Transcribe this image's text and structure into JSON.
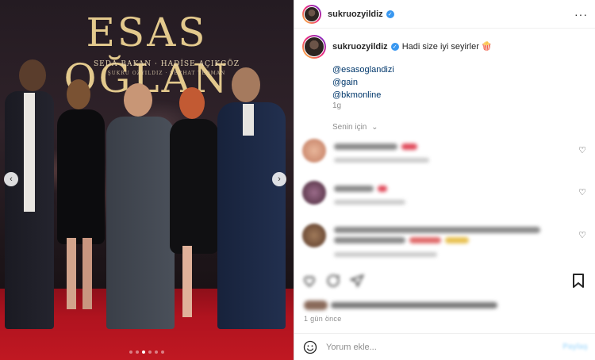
{
  "poster": {
    "title": "ESAS OĞLAN",
    "names_line1": "SEDA BAKAN · HADİSE AÇIKGÖZ",
    "names_line2": "ŞÜKRÜ ÖZYILDIZ · SERHAT TEOMAN"
  },
  "post": {
    "username": "sukruozyildiz",
    "more_label": "···"
  },
  "caption": {
    "username": "sukruozyildiz",
    "text": "Hadi size iyi seyirler 🍿",
    "tags": [
      "@esasoglandizi",
      "@gain",
      "@bkmonline"
    ],
    "time": "1g"
  },
  "sort_label": "Senin için",
  "date_label": "1 gün önce",
  "comment_input": {
    "placeholder": "Yorum ekle..."
  },
  "post_button": "Paylaş",
  "carousel": {
    "total": 6,
    "active": 2
  },
  "colors": {
    "verified": "#3897f0",
    "link": "#00376b",
    "muted": "#8e8e8e",
    "carpet": "#b0131f",
    "poster_gold": "#e3c98d"
  }
}
